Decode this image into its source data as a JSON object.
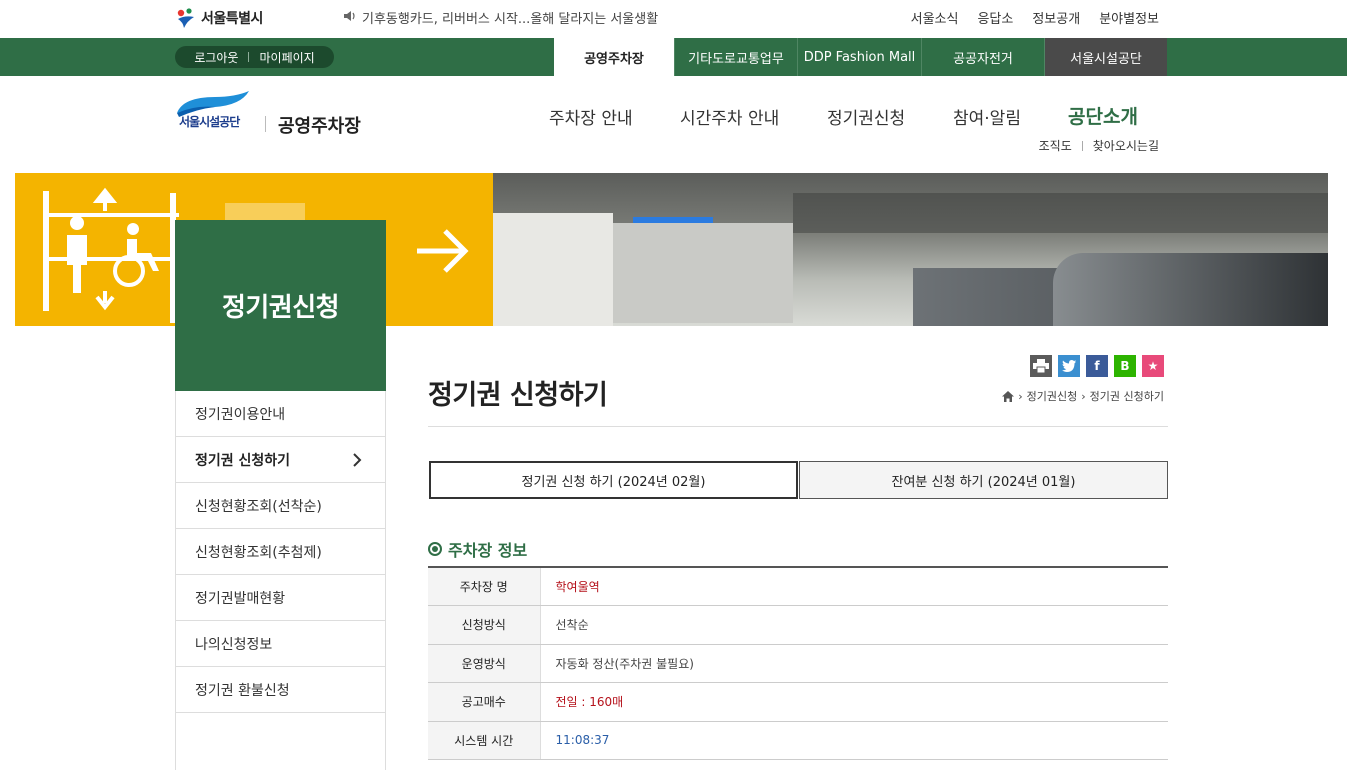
{
  "top": {
    "city_logo": "서울특별시",
    "notice": "기후동행카드, 리버버스 시작...올해 달라지는 서울생활",
    "links": [
      "서울소식",
      "응답소",
      "정보공개",
      "분야별정보"
    ]
  },
  "gnb": {
    "logout": "로그아웃",
    "mypage": "마이페이지",
    "tabs": [
      "공영주차장",
      "기타도로교통업무",
      "DDP Fashion Mall",
      "공공자전거",
      "서울시설공단"
    ]
  },
  "header": {
    "logo_text": "서울시설공단",
    "brand": "공영주차장",
    "nav": [
      "주차장 안내",
      "시간주차 안내",
      "정기권신청",
      "참여·알림",
      "공단소개"
    ],
    "sub_links": [
      "조직도",
      "찾아오시는길"
    ]
  },
  "sidebar": {
    "title": "정기권신청",
    "items": [
      "정기권이용안내",
      "정기권 신청하기",
      "신청현황조회(선착순)",
      "신청현황조회(추첨제)",
      "정기권발매현황",
      "나의신청정보",
      "정기권 환불신청"
    ]
  },
  "content": {
    "title": "정기권 신청하기",
    "share_icons": [
      "print-icon",
      "twitter-icon",
      "facebook-icon",
      "blog-icon",
      "bookmark-icon"
    ],
    "share_labels": [
      "",
      "",
      "f",
      "B",
      "★"
    ],
    "breadcrumb": [
      "정기권신청",
      "정기권 신청하기"
    ],
    "tabs": [
      "정기권 신청 하기 (2024년 02월)",
      "잔여분 신청 하기 (2024년 01월)"
    ],
    "section_title": "주차장 정보",
    "rows": [
      {
        "label": "주차장 명",
        "value": "학여울역"
      },
      {
        "label": "신청방식",
        "value": "선착순"
      },
      {
        "label": "운영방식",
        "value": "자동화 정산(주차권 불필요)"
      },
      {
        "label": "공고매수",
        "value": "전일 : 160매"
      },
      {
        "label": "시스템 시간",
        "value": "11:08:37"
      }
    ]
  },
  "colors": {
    "brand_green": "#2f6e46",
    "dark_tab": "#4a4a4a",
    "alert_red": "#b5121b",
    "time_blue": "#2a5ea8",
    "banner_yellow": "#f4b400"
  }
}
